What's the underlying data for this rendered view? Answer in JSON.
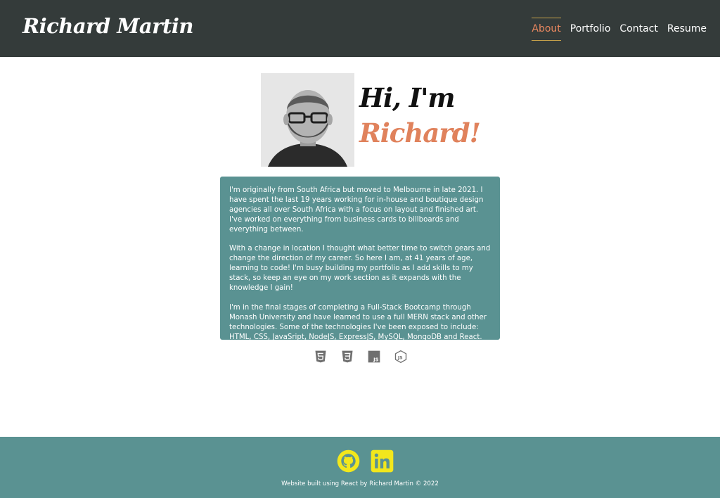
{
  "header": {
    "brand": "Richard Martin",
    "nav": [
      {
        "label": "About",
        "active": true
      },
      {
        "label": "Portfolio",
        "active": false
      },
      {
        "label": "Contact",
        "active": false
      },
      {
        "label": "Resume",
        "active": false
      }
    ]
  },
  "hero": {
    "greeting_line1": "Hi, I'm",
    "greeting_line2": "Richard!",
    "portrait_icon": "profile-photo"
  },
  "bio": {
    "paragraphs": [
      "I'm originally from South Africa but moved to Melbourne in late 2021. I have spent the last 19 years working for in-house and boutique design agencies all over South Africa with a focus on layout and finished art. I've worked on everything from business cards to billboards and everything between.",
      "With a change in location I thought what better time to switch gears and change the direction of my career. So here I am, at 41 years of age, learning to code! I'm busy building my portfolio as I add skills to my stack, so keep an eye on my work section as it expands with the knowledge I gain!",
      "I'm in the final stages of completing a Full-Stack Bootcamp through Monash University and have learned to use a full MERN stack and other technologies. Some of the technologies I've been exposed to include: HTML, CSS, JavaSript, NodeJS, ExpressJS, MySQL, MongoDB and React. I'm passionate about learning and building in this space!"
    ]
  },
  "tech_icons": [
    "html5-icon",
    "css3-icon",
    "javascript-icon",
    "nodejs-icon"
  ],
  "footer": {
    "social_icons": [
      "github-icon",
      "linkedin-icon"
    ],
    "credit": "Website built using React by Richard Martin © 2022"
  },
  "colors": {
    "header_bg": "#343b3a",
    "accent_orange": "#e0825c",
    "teal": "#5a9292",
    "social_yellow": "#f2e71c"
  }
}
